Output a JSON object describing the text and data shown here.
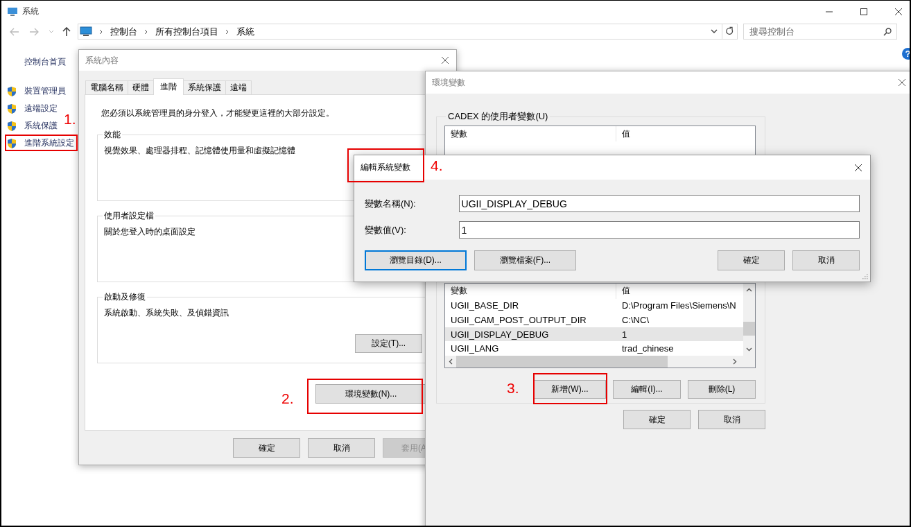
{
  "window": {
    "title": "系統"
  },
  "address_bar": {
    "breadcrumbs": [
      "控制台",
      "所有控制台項目",
      "系統"
    ]
  },
  "search": {
    "placeholder": "搜尋控制台"
  },
  "help": "?",
  "sidebar": {
    "home": "控制台首頁",
    "items": [
      {
        "label": "裝置管理員"
      },
      {
        "label": "遠端設定"
      },
      {
        "label": "系統保護"
      },
      {
        "label": "進階系統設定"
      }
    ]
  },
  "system_properties": {
    "title": "系統內容",
    "tabs": [
      {
        "label": "電腦名稱",
        "selected": false
      },
      {
        "label": "硬體",
        "selected": false
      },
      {
        "label": "進階",
        "selected": true
      },
      {
        "label": "系統保護",
        "selected": false
      },
      {
        "label": "遠端",
        "selected": false
      }
    ],
    "notice": "您必須以系統管理員的身分登入，才能變更這裡的大部分設定。",
    "groups": [
      {
        "title": "效能",
        "description": "視覺效果、處理器排程、記憶體使用量和虛擬記憶體"
      },
      {
        "title": "使用者設定檔",
        "description": "關於您登入時的桌面設定"
      },
      {
        "title": "啟動及修復",
        "description": "系統啟動、系統失敗、及偵錯資訊",
        "button": "設定(T)..."
      }
    ],
    "env_button": "環境變數(N)...",
    "buttons": [
      {
        "label": "確定",
        "disabled": false
      },
      {
        "label": "取消",
        "disabled": false
      },
      {
        "label": "套用(A",
        "disabled": true
      }
    ]
  },
  "environment_variables": {
    "title": "環境變數",
    "user_group": {
      "title": "CADEX 的使用者變數(U)",
      "columns": [
        "變數",
        "值"
      ]
    },
    "system_table": {
      "columns": [
        "變數",
        "值"
      ],
      "rows": [
        {
          "cells": [
            "UGII_BASE_DIR",
            "D:\\Program Files\\Siemens\\N"
          ],
          "selected": false
        },
        {
          "cells": [
            "UGII_CAM_POST_OUTPUT_DIR",
            "C:\\NC\\"
          ],
          "selected": false
        },
        {
          "cells": [
            "UGII_DISPLAY_DEBUG",
            "1"
          ],
          "selected": true
        },
        {
          "cells": [
            "UGII_LANG",
            "trad_chinese"
          ],
          "selected": false
        }
      ]
    },
    "buttons": [
      "新增(W)...",
      "編輯(I)...",
      "刪除(L)"
    ],
    "footer_buttons": [
      "確定",
      "取消"
    ]
  },
  "edit_dialog": {
    "title": "編輯系統變數",
    "fields": [
      {
        "label": "變數名稱(N):",
        "value": "UGII_DISPLAY_DEBUG"
      },
      {
        "label": "變數值(V):",
        "value": "1"
      }
    ],
    "browse_buttons": [
      {
        "label": "瀏覽目錄(D)...",
        "focused": true
      },
      {
        "label": "瀏覽檔案(F)...",
        "focused": false
      }
    ],
    "buttons": [
      "確定",
      "取消"
    ]
  },
  "annotations": [
    {
      "label": "1."
    },
    {
      "label": "2."
    },
    {
      "label": "3."
    },
    {
      "label": "4."
    }
  ]
}
